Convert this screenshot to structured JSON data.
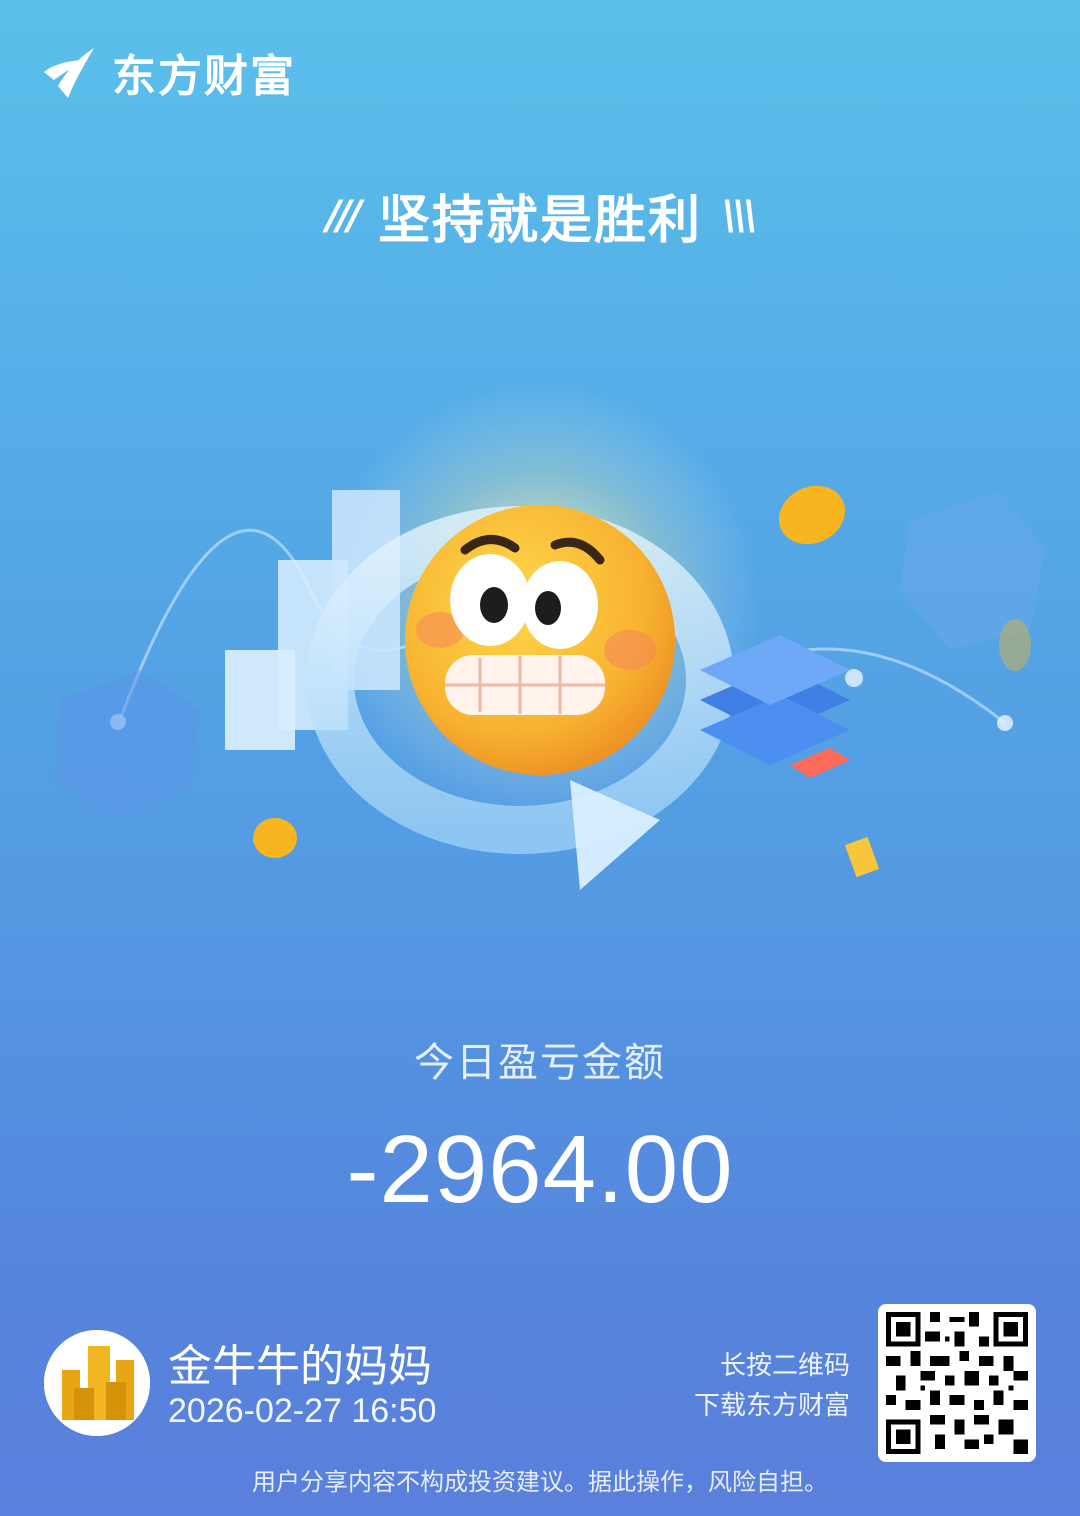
{
  "brand": {
    "name": "东方财富",
    "icon": "eastmoney-logo-icon"
  },
  "slogan": {
    "text": "坚持就是胜利",
    "left_deco": "///",
    "right_deco": "\\\\\\"
  },
  "pnl": {
    "label": "今日盈亏金额",
    "value": "-2964.00"
  },
  "user": {
    "name": "金牛牛的妈妈",
    "datetime": "2026-02-27 16:50",
    "avatar_icon": "gold-bars-avatar-icon"
  },
  "qr": {
    "hint_line1": "长按二维码",
    "hint_line2": "下载东方财富",
    "icon": "qr-code-icon"
  },
  "disclaimer": "用户分享内容不构成投资建议。据此操作，风险自担。",
  "colors": {
    "bg_top": "#5cc0ea",
    "bg_bottom": "#5a7fdc",
    "emoji": "#f7b733",
    "text": "#ffffff"
  }
}
